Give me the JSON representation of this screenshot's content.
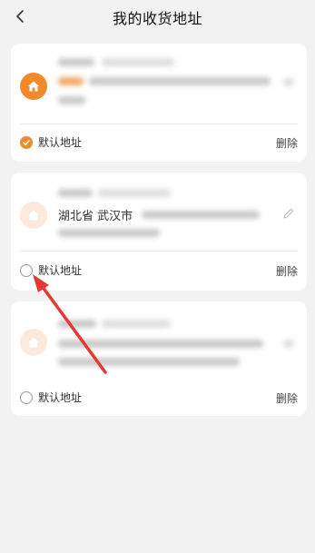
{
  "header": {
    "title": "我的收货地址"
  },
  "addresses": [
    {
      "default_label": "默认地址",
      "delete_label": "删除",
      "is_default": true
    },
    {
      "address_visible": "湖北省 武汉市",
      "default_label": "默认地址",
      "delete_label": "删除",
      "is_default": false
    },
    {
      "default_label": "默认地址",
      "delete_label": "删除",
      "is_default": false
    }
  ],
  "colors": {
    "accent": "#f08a2c",
    "annotation_arrow": "#e53935",
    "background": "#f2f2f2"
  },
  "icons": [
    "back-arrow-icon",
    "home-icon",
    "edit-pencil-icon",
    "check-icon"
  ]
}
